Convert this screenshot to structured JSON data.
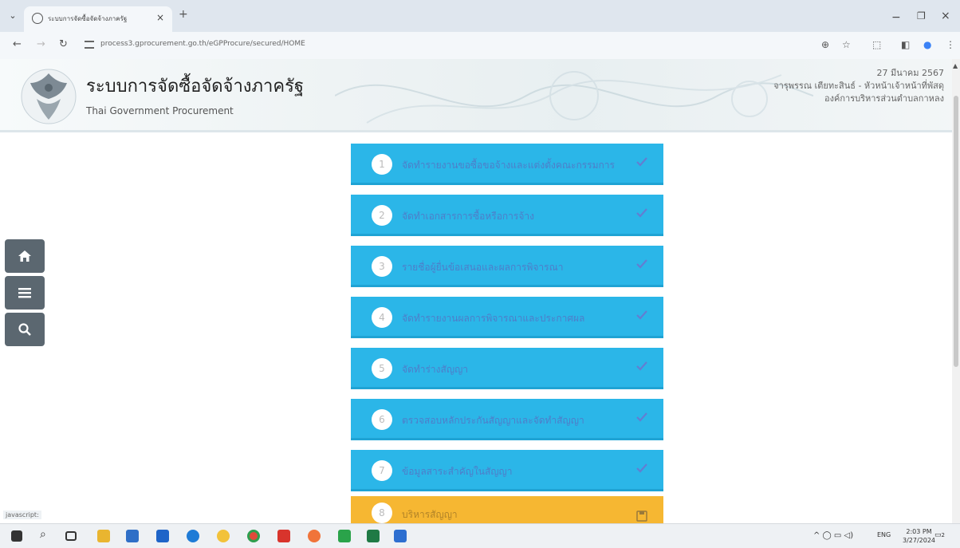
{
  "browser": {
    "tab_title": "ระบบการจัดซื้อจัดจ้างภาครัฐ",
    "url": "process3.gprocurement.go.th/eGPProcure/secured/HOME",
    "status_text": "javascript:"
  },
  "header": {
    "title": "ระบบการจัดซื้อจัดจ้างภาครัฐ",
    "subtitle": "Thai Government Procurement",
    "date": "27 มีนาคม 2567",
    "user": "จารุพรรณ เตียทะสินธ์ - หัวหน้าเจ้าหน้าที่พัสดุ",
    "agency": "องค์การบริหารส่วนตำบลกาหลง"
  },
  "steps": [
    {
      "num": "1",
      "label": "จัดทำรายงานขอซื้อขอจ้างและแต่งตั้งคณะกรรมการ",
      "color": "#2bb6e8",
      "status": "check"
    },
    {
      "num": "2",
      "label": "จัดทำเอกสารการซื้อหรือการจ้าง",
      "color": "#2bb6e8",
      "status": "check"
    },
    {
      "num": "3",
      "label": "รายชื่อผู้ยื่นข้อเสนอและผลการพิจารณา",
      "color": "#2bb6e8",
      "status": "check"
    },
    {
      "num": "4",
      "label": "จัดทำรายงานผลการพิจารณาและประกาศผล",
      "color": "#2bb6e8",
      "status": "check"
    },
    {
      "num": "5",
      "label": "จัดทำร่างสัญญา",
      "color": "#2bb6e8",
      "status": "check"
    },
    {
      "num": "6",
      "label": "ตรวจสอบหลักประกันสัญญาและจัดทำสัญญา",
      "color": "#2bb6e8",
      "status": "check"
    },
    {
      "num": "7",
      "label": "ข้อมูลสาระสำคัญในสัญญา",
      "color": "#2bb6e8",
      "status": "check"
    },
    {
      "num": "8",
      "label": "บริหารสัญญา",
      "color": "#f6b732",
      "status": "save"
    }
  ],
  "taskbar": {
    "language": "ENG",
    "time": "2:03 PM",
    "date": "3/27/2024",
    "notifications": "2"
  }
}
